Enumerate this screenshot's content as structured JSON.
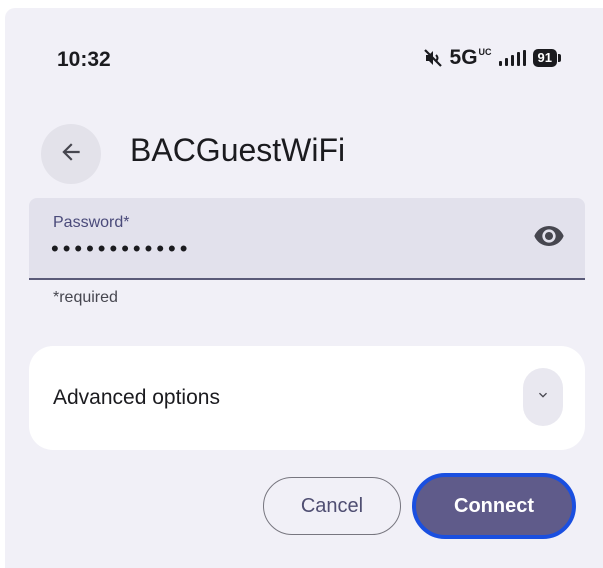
{
  "colors": {
    "background": "#f1f0f7",
    "field_background": "#e2e1ec",
    "primary_button": "#5f5b8a",
    "focus_ring": "#1a4fe0",
    "label_accent": "#4a4a7a"
  },
  "status_bar": {
    "time": "10:32",
    "network_type": "5G",
    "network_subscript": "UC",
    "battery_level": "91",
    "icons": [
      "mute-icon",
      "signal-icon",
      "battery-icon"
    ]
  },
  "header": {
    "back_icon": "arrow-back-icon",
    "title": "BACGuestWiFi"
  },
  "password": {
    "label": "Password*",
    "masked_value": "••••••••••••",
    "toggle_icon": "eye-icon",
    "helper": "*required"
  },
  "advanced": {
    "label": "Advanced options",
    "expand_icon": "chevron-down-icon"
  },
  "actions": {
    "cancel_label": "Cancel",
    "connect_label": "Connect"
  }
}
